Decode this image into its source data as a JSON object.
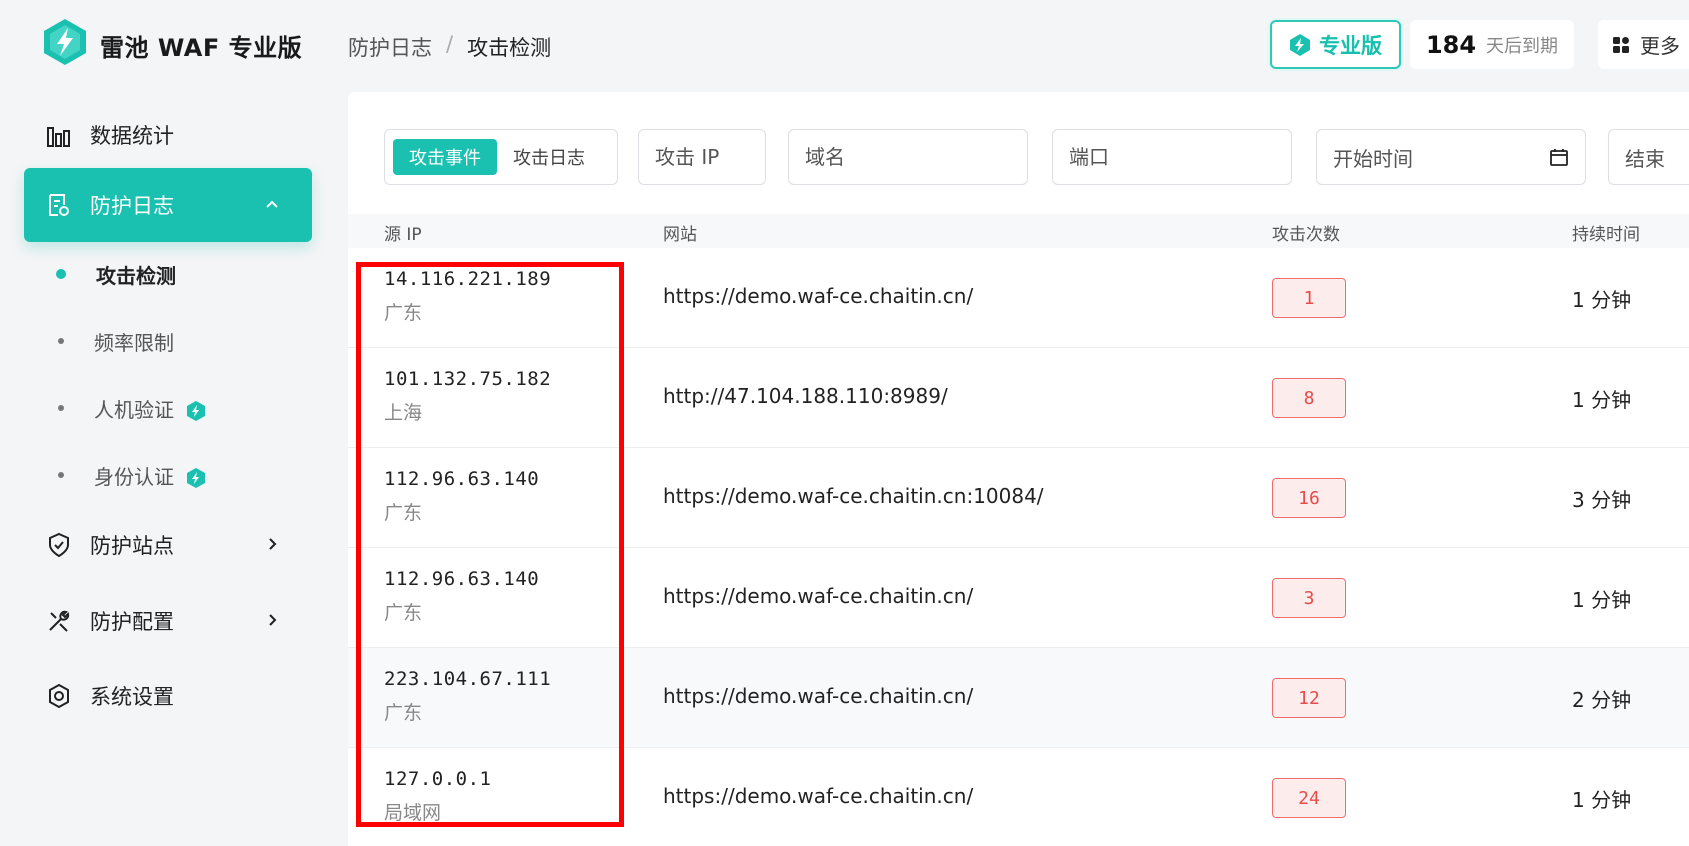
{
  "header": {
    "brand": "雷池 WAF 专业版",
    "breadcrumb": [
      "防护日志",
      "/",
      "攻击检测"
    ],
    "pro_badge": "专业版",
    "expire_days": "184",
    "expire_label": "天后到期",
    "more_label": "更多"
  },
  "sidebar": {
    "items": [
      {
        "label": "数据统计",
        "icon": "bar-chart-icon"
      },
      {
        "label": "防护日志",
        "icon": "log-document-icon"
      },
      {
        "label": "防护站点",
        "icon": "shield-icon"
      },
      {
        "label": "防护配置",
        "icon": "tools-icon"
      },
      {
        "label": "系统设置",
        "icon": "gear-icon"
      }
    ],
    "sub_items": [
      {
        "label": "攻击检测"
      },
      {
        "label": "频率限制"
      },
      {
        "label": "人机验证"
      },
      {
        "label": "身份认证"
      }
    ]
  },
  "filters": {
    "tab_events": "攻击事件",
    "tab_logs": "攻击日志",
    "ip_placeholder": "攻击 IP",
    "domain_placeholder": "域名",
    "port_placeholder": "端口",
    "start_time": "开始时间",
    "end_time": "结束"
  },
  "table": {
    "headers": [
      "源 IP",
      "网站",
      "攻击次数",
      "持续时间"
    ],
    "rows": [
      {
        "ip": "14.116.221.189",
        "region": "广东",
        "site": "https://demo.waf-ce.chaitin.cn/",
        "count": "1",
        "duration": "1 分钟"
      },
      {
        "ip": "101.132.75.182",
        "region": "上海",
        "site": "http://47.104.188.110:8989/",
        "count": "8",
        "duration": "1 分钟"
      },
      {
        "ip": "112.96.63.140",
        "region": "广东",
        "site": "https://demo.waf-ce.chaitin.cn:10084/",
        "count": "16",
        "duration": "3 分钟"
      },
      {
        "ip": "112.96.63.140",
        "region": "广东",
        "site": "https://demo.waf-ce.chaitin.cn/",
        "count": "3",
        "duration": "1 分钟"
      },
      {
        "ip": "223.104.67.111",
        "region": "广东",
        "site": "https://demo.waf-ce.chaitin.cn/",
        "count": "12",
        "duration": "2 分钟"
      },
      {
        "ip": "127.0.0.1",
        "region": "局域网",
        "site": "https://demo.waf-ce.chaitin.cn/",
        "count": "24",
        "duration": "1 分钟"
      }
    ]
  },
  "colors": {
    "accent": "#1ac0b0",
    "count_border": "#f36b6b",
    "count_bg": "#fdecec",
    "highlight": "#ff0000"
  }
}
